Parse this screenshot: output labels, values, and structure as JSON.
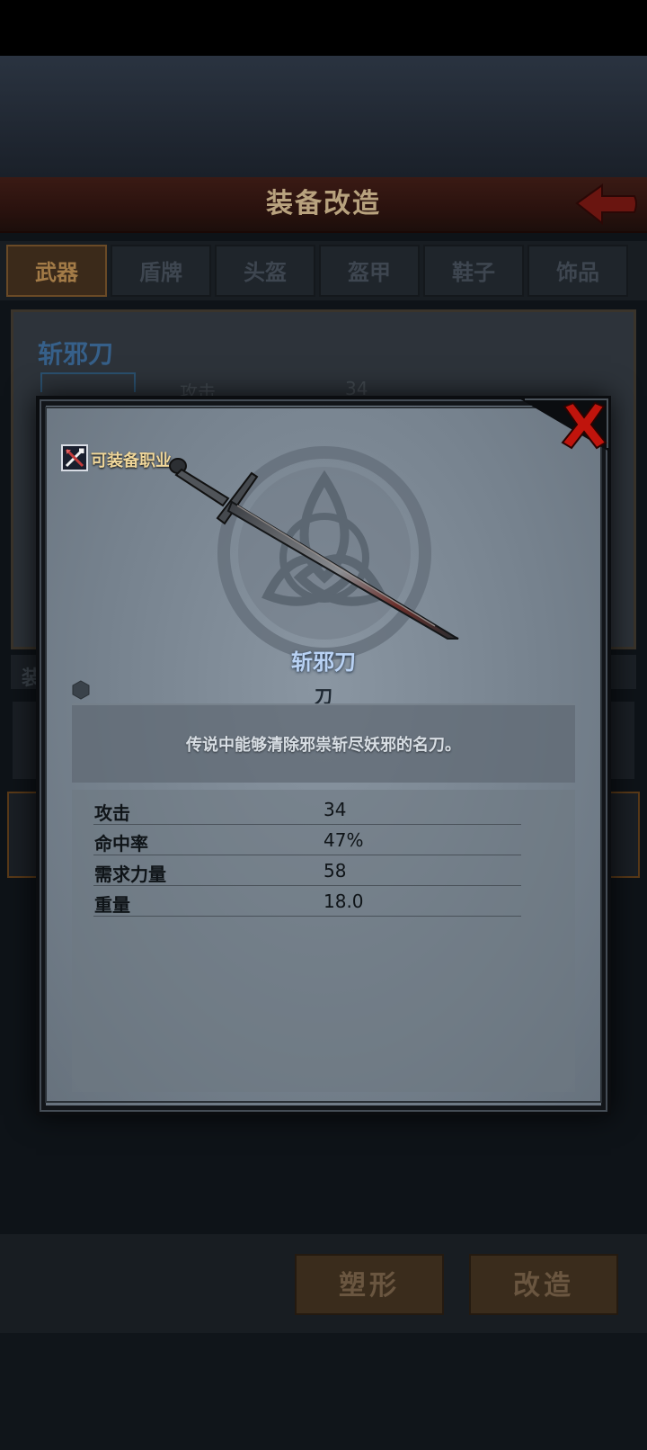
{
  "header": {
    "title": "装备改造"
  },
  "tabs": [
    {
      "label": "武器",
      "active": true
    },
    {
      "label": "盾牌",
      "active": false
    },
    {
      "label": "头盔",
      "active": false
    },
    {
      "label": "盔甲",
      "active": false
    },
    {
      "label": "鞋子",
      "active": false
    },
    {
      "label": "饰品",
      "active": false
    }
  ],
  "background_card": {
    "item_name": "斩邪刀",
    "stat_label": "攻击",
    "stat_value": "34",
    "list_label": "装"
  },
  "bottom_buttons": {
    "reshape_label": "塑形",
    "modify_label": "改造"
  },
  "popup": {
    "class_label": "可装备职业",
    "item_name": "斩邪刀",
    "item_type": "刀",
    "description": "传说中能够清除邪祟斩尽妖邪的名刀。",
    "stats": [
      {
        "label": "攻击",
        "value": "34"
      },
      {
        "label": "命中率",
        "value": "47%"
      },
      {
        "label": "需求力量",
        "value": "58"
      },
      {
        "label": "重量",
        "value": "18.0"
      }
    ]
  },
  "icons": {
    "back": "back-arrow-icon",
    "close": "close-icon",
    "class": "class-swords-icon",
    "rarity": "rarity-gem-icon",
    "emblem": "triquetra-emblem-icon",
    "weapon": "sword-icon"
  },
  "colors": {
    "accent_gold": "#f0d79a",
    "item_name_blue": "#b9d2f4",
    "close_red": "#c0140c",
    "header_red": "#3a1a14"
  }
}
